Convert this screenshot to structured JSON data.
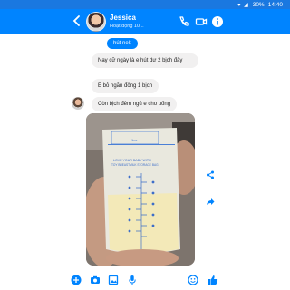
{
  "status_bar": {
    "signal": "▾ ◢",
    "battery": "30%",
    "time": "14:40"
  },
  "header": {
    "contact_name": "Jessica",
    "presence": "Hoạt động 10..."
  },
  "messages": [
    {
      "from": "me",
      "text": "hút nek"
    },
    {
      "from": "them",
      "text": "Nay cữ ngày là e hút dư 2 bịch đây"
    },
    {
      "from": "them",
      "text": "E bỏ ngăn đông 1 bịch"
    },
    {
      "from": "them",
      "text": "Còn bịch đêm ngủ e cho uống"
    }
  ],
  "photo": {
    "bag_label_top": "1oz",
    "bag_text_line1": "LOVE YOUR BABY WITH",
    "bag_text_line2": "TOY BREASTMILK STORAGE BAG"
  },
  "colors": {
    "brand": "#0084ff",
    "status": "#1a78e0",
    "bubble": "#f1f0f0",
    "sent": "#0084ff"
  },
  "icons": {
    "back": "back-arrow-icon",
    "call": "phone-icon",
    "video": "video-camera-icon",
    "info": "info-icon",
    "share": "share-icon",
    "forward": "forward-icon",
    "plus": "plus-circle-icon",
    "camera": "camera-icon",
    "gallery": "gallery-icon",
    "mic": "microphone-icon",
    "emoji": "emoji-icon",
    "like": "thumbs-up-icon"
  }
}
